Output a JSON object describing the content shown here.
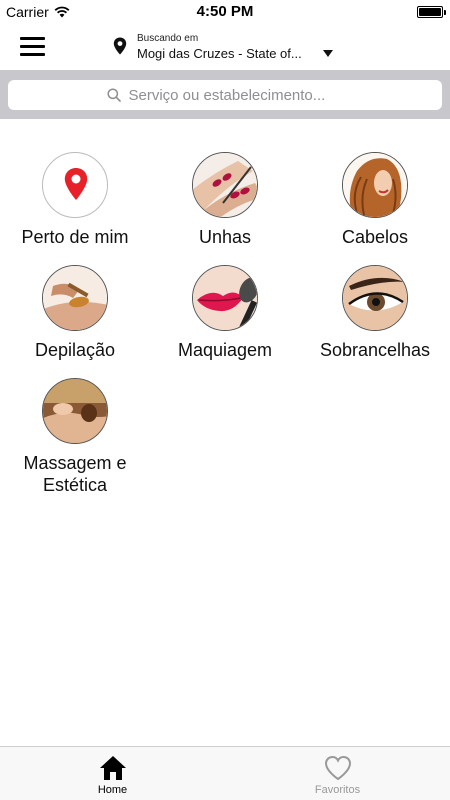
{
  "status_bar": {
    "carrier": "Carrier",
    "time": "4:50 PM",
    "battery_level": 1.0
  },
  "header": {
    "location_label": "Buscando em",
    "location_value": "Mogi das Cruzes - State of..."
  },
  "search": {
    "placeholder": "Serviço ou estabelecimento..."
  },
  "categories": [
    {
      "label": "Perto de mim",
      "icon": "map-pin-icon"
    },
    {
      "label": "Unhas",
      "icon": "nails-photo"
    },
    {
      "label": "Cabelos",
      "icon": "hair-photo"
    },
    {
      "label": "Depilação",
      "icon": "waxing-photo"
    },
    {
      "label": "Maquiagem",
      "icon": "makeup-photo"
    },
    {
      "label": "Sobrancelhas",
      "icon": "eyebrow-photo"
    },
    {
      "label": "Massagem e Estética",
      "icon": "massage-photo"
    }
  ],
  "tabbar": {
    "tabs": [
      {
        "label": "Home",
        "icon": "home-icon",
        "active": true
      },
      {
        "label": "Favoritos",
        "icon": "heart-icon",
        "active": false
      }
    ]
  },
  "colors": {
    "accent_red": "#e8202a",
    "search_bg": "#c8c8cc",
    "inactive": "#999999"
  }
}
